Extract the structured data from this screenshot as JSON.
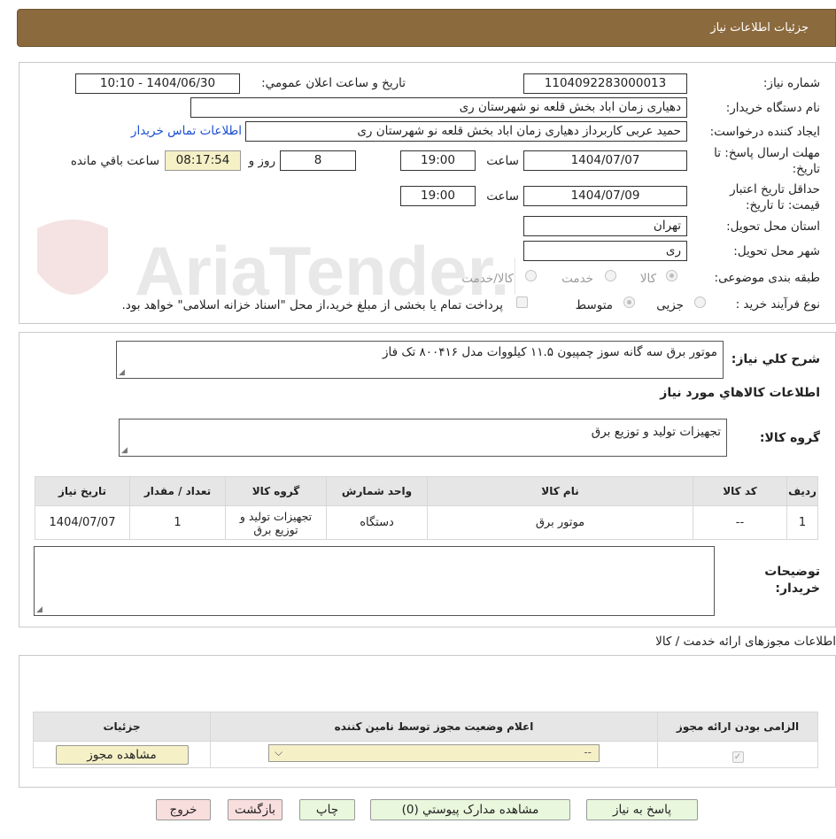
{
  "header": {
    "title": "جزئیات اطلاعات نیاز"
  },
  "watermark": {
    "text": "AriaTender.net"
  },
  "form": {
    "need_number_label": "شماره نیاز:",
    "need_number": "1104092283000013",
    "announce_label": "تاریخ و ساعت اعلان عمومي:",
    "announce_value": "1404/06/30 - 10:10",
    "buyer_org_label": "نام دستگاه خريدار:",
    "buyer_org": "دهیاری زمان اباد بخش قلعه نو شهرستان ری",
    "creator_label": "ایجاد کننده درخواست:",
    "creator": "حمید  عربی کاربرداز دهیاری زمان اباد بخش قلعه نو شهرستان ری",
    "contact_link": "اطلاعات تماس خریدار",
    "deadline_label_1": "مهلت ارسال پاسخ: تا",
    "deadline_label_2": "تاریخ:",
    "deadline_date": "1404/07/07",
    "time_label": "ساعت",
    "deadline_time": "19:00",
    "days": "8",
    "days_label": "روز و",
    "remaining": "08:17:54",
    "remaining_label": "ساعت باقي مانده",
    "validity_label_1": "حداقل تاریخ اعتبار",
    "validity_label_2": "قیمت: تا تاریخ:",
    "validity_date": "1404/07/09",
    "validity_time": "19:00",
    "province_label": "استان محل تحویل:",
    "province": "تهران",
    "city_label": "شهر محل تحویل:",
    "city": "ری",
    "category_label": "طبقه بندی موضوعی:",
    "category_options": [
      "کالا",
      "خدمت",
      "کالا/خدمت"
    ],
    "process_label": "نوع فرآیند خرید :",
    "process_options": [
      "جزیی",
      "متوسط"
    ],
    "process_note": "پرداخت تمام یا بخشی از مبلغ خرید،از محل \"اسناد خزانه اسلامی\" خواهد بود."
  },
  "details": {
    "summary_label": "شرح کلي نياز:",
    "summary": "موتور برق سه گانه سوز چمپیون ۱۱.۵ کیلووات مدل ۸۰۰۴۱۶ تک فاز",
    "goods_info_title": "اطلاعات کالاهاي مورد نياز",
    "goods_group_label": "گروه کالا:",
    "goods_group": "تجهیزات تولید و توزیع برق",
    "table_headers": [
      "رديف",
      "کد کالا",
      "نام کالا",
      "واحد شمارش",
      "گروه کالا",
      "تعداد / مقدار",
      "تاريخ نياز"
    ],
    "table_rows": [
      [
        "1",
        "--",
        "موتور برق",
        "دستگاه",
        "تجهیزات تولید و توزیع برق",
        "1",
        "1404/07/07"
      ]
    ],
    "buyer_notes_label_1": "توضيحات",
    "buyer_notes_label_2": "خريدار:"
  },
  "permits": {
    "title": "اطلاعات مجوزهای ارائه خدمت / کالا",
    "headers": [
      "الزامی بودن ارائه مجوز",
      "اعلام وضعیت مجوز توسط نامین کننده",
      "جزئیات"
    ],
    "select_value": "--",
    "view_button": "مشاهده مجوز"
  },
  "buttons": {
    "reply": "پاسخ به نياز",
    "attachments": "مشاهده مدارک پيوستي (0)",
    "print": "چاپ",
    "back": "بازگشت",
    "exit": "خروج"
  }
}
